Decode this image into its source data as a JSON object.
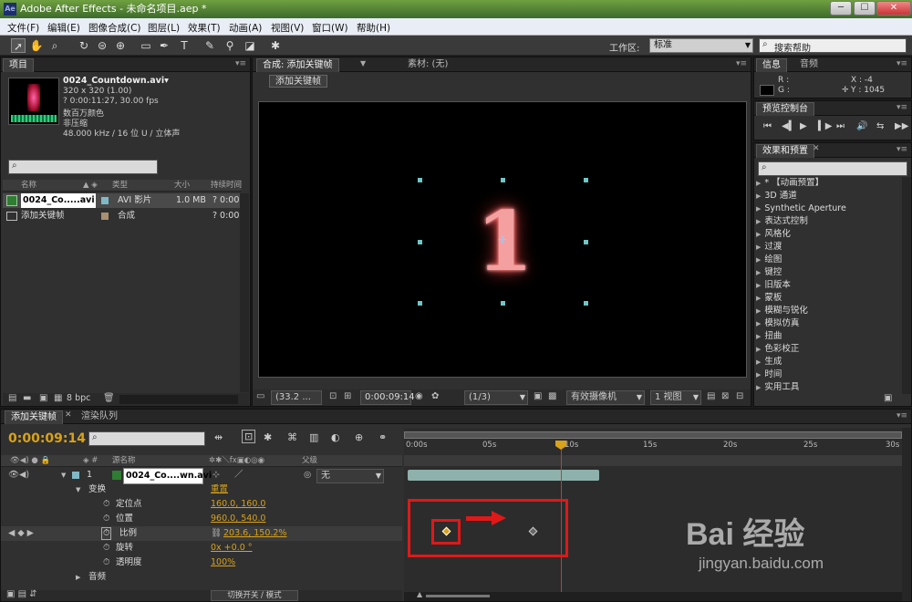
{
  "window": {
    "title": "Adobe After Effects - 未命名项目.aep *",
    "logo": "Ae",
    "minimize": "─",
    "maximize": "☐",
    "close": "✕"
  },
  "menu": [
    "文件(F)",
    "编辑(E)",
    "图像合成(C)",
    "图层(L)",
    "效果(T)",
    "动画(A)",
    "视图(V)",
    "窗口(W)",
    "帮助(H)"
  ],
  "toolbar": {
    "workspace_label": "工作区:",
    "workspace_value": "标准",
    "search_placeholder": "搜索帮助",
    "tools": [
      "selection-tool-icon",
      "hand-tool-icon",
      "zoom-tool-icon",
      "rotate-tool-icon",
      "camera-orbit-icon",
      "pan-behind-icon",
      "mask-rect-icon",
      "pen-tool-icon",
      "text-tool-icon",
      "brush-tool-icon",
      "clone-stamp-icon",
      "eraser-tool-icon",
      "puppet-tool-icon"
    ]
  },
  "project": {
    "tab": "项目",
    "file_name": "0024_Countdown.avi▾",
    "details": [
      "320 x 320 (1.00)",
      "? 0:00:11:27, 30.00 fps",
      "数百万颜色",
      "非压缩",
      "48.000 kHz / 16 位 U / 立体声"
    ],
    "columns": [
      "名称",
      "类型",
      "大小",
      "持续时间"
    ],
    "items": [
      {
        "name": "0024_Co.....avi",
        "type": "AVI 影片",
        "size": "1.0 MB",
        "duration": "? 0:00"
      },
      {
        "name": "添加关键帧",
        "type": "合成",
        "size": "",
        "duration": "? 0:00"
      }
    ],
    "bpc": "8 bpc"
  },
  "composition": {
    "tab": "合成: 添加关键帧",
    "footage_tab": "素材: (无)",
    "sub_tab": "添加关键帧",
    "digit": "1",
    "zoom": "(33.2 ...",
    "timecode": "0:00:09:14",
    "resolution": "(1/3)",
    "camera": "有效摄像机",
    "views": "1 视图"
  },
  "info": {
    "tabs": [
      "信息",
      "音频"
    ],
    "r": "R :",
    "g": "G :",
    "x": "X : -4",
    "y": "Y : 1045"
  },
  "preview": {
    "tab": "预览控制台"
  },
  "effects": {
    "tab": "效果和预置",
    "items": [
      "* 【动画预置】",
      "3D 通道",
      "Synthetic Aperture",
      "表达式控制",
      "风格化",
      "过渡",
      "绘图",
      "键控",
      "旧版本",
      "蒙板",
      "模糊与锐化",
      "模拟仿真",
      "扭曲",
      "色彩校正",
      "生成",
      "时间",
      "实用工具"
    ]
  },
  "timeline": {
    "tabs": [
      "添加关键帧",
      "渲染队列"
    ],
    "timecode": "0:00:09:14",
    "col_source": "源名称",
    "col_parent": "父级",
    "layer": {
      "num": "1",
      "name": "0024_Co....wn.avi",
      "parent": "无"
    },
    "transform": "变换",
    "reset": "重置",
    "props": [
      {
        "name": "定位点",
        "value": "160.0, 160.0"
      },
      {
        "name": "位置",
        "value": "960.0, 540.0"
      },
      {
        "name": "比例",
        "value": "203.6, 150.2%"
      },
      {
        "name": "旋转",
        "value": "0x +0.0 °"
      },
      {
        "name": "透明度",
        "value": "100%"
      }
    ],
    "audio": "音频",
    "ruler": [
      "0:00s",
      "05s",
      "10s",
      "15s",
      "20s",
      "25s",
      "30s"
    ],
    "toggle_label": "切换开关 / 模式"
  },
  "watermark": {
    "brand": "Bai 经验",
    "url": "jingyan.baidu.com"
  },
  "colors": {
    "accent": "#d8a21a",
    "annotation": "#e01818",
    "handle": "#6ec6c6"
  }
}
